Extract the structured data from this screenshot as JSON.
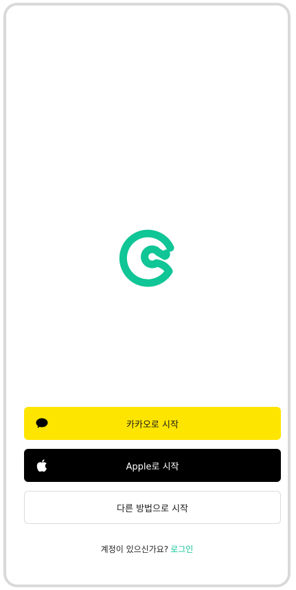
{
  "app": {
    "accent_color": "#10c596",
    "logo_icon": "c-swirl-logo-icon"
  },
  "buttons": {
    "kakao": {
      "label": "카카오로 시작",
      "icon": "speech-bubble-icon",
      "bg_color": "#fee500"
    },
    "apple": {
      "label": "Apple로 시작",
      "icon": "apple-icon",
      "bg_color": "#000000"
    },
    "other": {
      "label": "다른 방법으로 시작"
    }
  },
  "login": {
    "prompt": "계정이 있으신가요?",
    "link_label": "로그인"
  }
}
